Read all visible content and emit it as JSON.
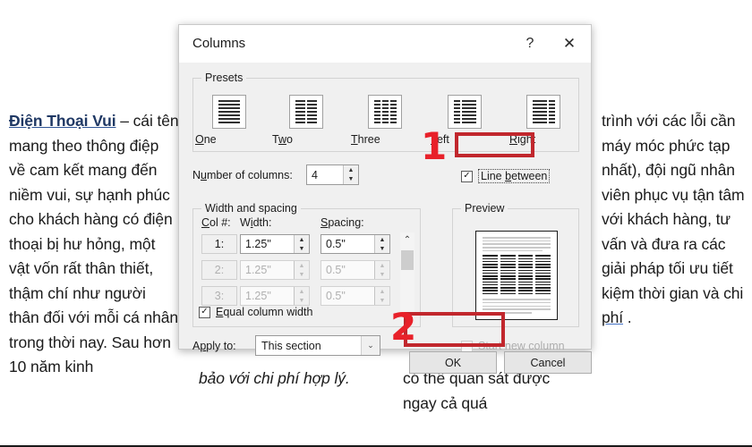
{
  "document": {
    "left_column": {
      "link_text": "Điện Thoại Vui",
      "body": " – cái tên mang theo thông điệp về cam kết mang đến niềm vui, sự hạnh phúc cho khách hàng có điện thoại bị hư hỏng, một vật vốn rất thân thiết, thậm chí như người thân đối với mỗi cá nhân trong thời nay. Sau hơn 10 năm kinh"
    },
    "right_column": {
      "body_before": "trình với các lỗi cần máy móc phức tạp nhất), đội ngũ nhân viên phục vụ tận tâm với khách hàng, tư vấn và đưa ra các giải pháp tối ưu tiết kiệm thời gian và chi ",
      "link_text": "phí",
      "body_after": " ."
    },
    "bottom_left": "bảo với chi phí hợp lý.",
    "bottom_right": "có thể quan sát được ngay cả quá"
  },
  "dialog": {
    "title": "Columns",
    "help_icon": "?",
    "close_icon": "✕",
    "presets": {
      "legend": "Presets",
      "items": [
        {
          "label": "One",
          "label_pre": "",
          "label_key": "O",
          "label_post": "ne",
          "bars": [
            1,
            1,
            1,
            1,
            1,
            1
          ],
          "columns": 1
        },
        {
          "label": "Two",
          "label_pre": "T",
          "label_key": "w",
          "label_post": "o",
          "columns": 2
        },
        {
          "label": "Three",
          "label_pre": "",
          "label_key": "T",
          "label_post": "hree",
          "columns": 3
        },
        {
          "label": "Left",
          "label_pre": "",
          "label_key": "L",
          "label_post": "eft",
          "columns": 2
        },
        {
          "label": "Right",
          "label_pre": "",
          "label_key": "R",
          "label_post": "ight",
          "columns": 2
        }
      ]
    },
    "number_of_columns": {
      "label_pre": "N",
      "label_key": "u",
      "label_post": "mber of columns:",
      "label": "Number of columns:",
      "value": "4"
    },
    "line_between": {
      "label_pre": "Line ",
      "label_key": "b",
      "label_post": "etween",
      "label": "Line between",
      "checked": true,
      "check_glyph": "✓"
    },
    "width_spacing": {
      "legend": "Width and spacing",
      "headers": {
        "col": "Col #:",
        "col_key": "C",
        "width": "Width:",
        "width_key": "i",
        "spacing": "Spacing:",
        "spacing_key": "S"
      },
      "rows": [
        {
          "col": "1:",
          "width": "1.25\"",
          "spacing": "0.5\"",
          "enabled": true
        },
        {
          "col": "2:",
          "width": "1.25\"",
          "spacing": "0.5\"",
          "enabled": false
        },
        {
          "col": "3:",
          "width": "1.25\"",
          "spacing": "0.5\"",
          "enabled": false
        }
      ],
      "equal_column_width": {
        "label_pre": "",
        "label_key": "E",
        "label_post": "qual column width",
        "label": "Equal column width",
        "checked": true,
        "check_glyph": "✓"
      }
    },
    "preview": {
      "legend": "Preview",
      "columns": 4,
      "line_between": true
    },
    "start_new_column": {
      "label": "Start new column",
      "checked": false,
      "enabled": false
    },
    "apply_to": {
      "label_pre": "A",
      "label_key": "p",
      "label_post": "ply to:",
      "label": "Apply to:",
      "value": "This section",
      "caret_icon": "⌄"
    },
    "buttons": {
      "ok": "OK",
      "cancel": "Cancel"
    },
    "spinner": {
      "up": "▲",
      "down": "▼"
    },
    "scroll": {
      "up": "⌃",
      "down": "⌄"
    }
  },
  "annotations": {
    "step_one": "1",
    "step_two": "2",
    "highlight_color": "#c1272d",
    "number_color": "#e8212a"
  }
}
